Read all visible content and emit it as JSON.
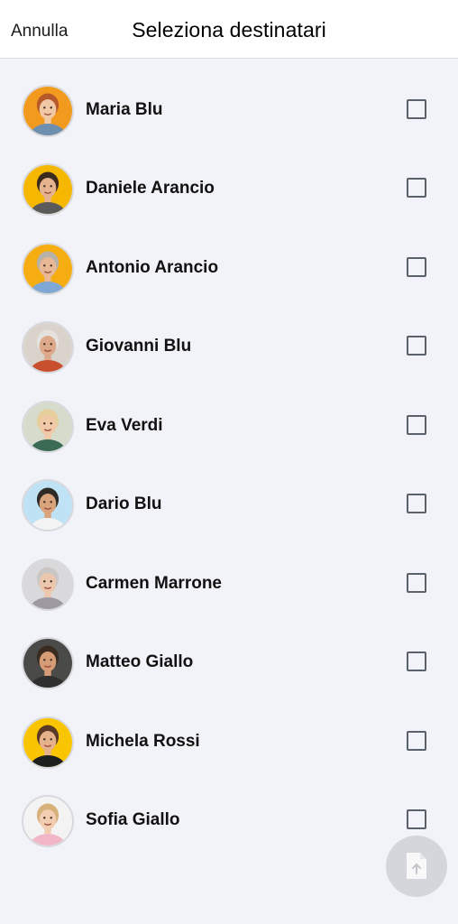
{
  "header": {
    "cancel_label": "Annulla",
    "title": "Seleziona destinatari"
  },
  "recipients": [
    {
      "name": "",
      "checked": false,
      "avatar": {
        "bg": "#b9d8f0",
        "skin": "#e9c8a8",
        "hair": "#c9b9a0",
        "shirt": "#8fb5d8"
      }
    },
    {
      "name": "Maria Blu",
      "checked": false,
      "avatar": {
        "bg": "#f29a1e",
        "skin": "#f1c8a6",
        "hair": "#b5582a",
        "shirt": "#6f8fb0"
      }
    },
    {
      "name": "Daniele Arancio",
      "checked": false,
      "avatar": {
        "bg": "#f6b700",
        "skin": "#e5b48e",
        "hair": "#3b2a1e",
        "shirt": "#5a5a5a"
      }
    },
    {
      "name": "Antonio Arancio",
      "checked": false,
      "avatar": {
        "bg": "#f6ad12",
        "skin": "#e8b895",
        "hair": "#b7b2a8",
        "shirt": "#7fa8d6"
      }
    },
    {
      "name": "Giovanni Blu",
      "checked": false,
      "avatar": {
        "bg": "#d9d3cc",
        "skin": "#dca98a",
        "hair": "#e5e2dd",
        "shirt": "#c8502e"
      }
    },
    {
      "name": "Eva Verdi",
      "checked": false,
      "avatar": {
        "bg": "#d5dccb",
        "skin": "#efc9a8",
        "hair": "#e6cf9a",
        "shirt": "#3b6b55"
      }
    },
    {
      "name": "Dario Blu",
      "checked": false,
      "avatar": {
        "bg": "#bfe3f5",
        "skin": "#d9a37c",
        "hair": "#2e2a26",
        "shirt": "#f3f3f3"
      }
    },
    {
      "name": "Carmen Marrone",
      "checked": false,
      "avatar": {
        "bg": "#d9d9dc",
        "skin": "#ecc7ad",
        "hair": "#c9c6c4",
        "shirt": "#9c9aa0"
      }
    },
    {
      "name": "Matteo Giallo",
      "checked": false,
      "avatar": {
        "bg": "#4a4a48",
        "skin": "#d59c76",
        "hair": "#3a2a20",
        "shirt": "#2f2f2f"
      }
    },
    {
      "name": "Michela Rossi",
      "checked": false,
      "avatar": {
        "bg": "#f9c500",
        "skin": "#e6b28c",
        "hair": "#5a3a25",
        "shirt": "#1e1e1e"
      }
    },
    {
      "name": "Sofia Giallo",
      "checked": false,
      "avatar": {
        "bg": "#f3f3f3",
        "skin": "#f2cdb2",
        "hair": "#d7b07a",
        "shirt": "#f2b7c6"
      }
    }
  ],
  "fab": {
    "icon": "upload-document-icon",
    "color": "#d3d4d9"
  }
}
